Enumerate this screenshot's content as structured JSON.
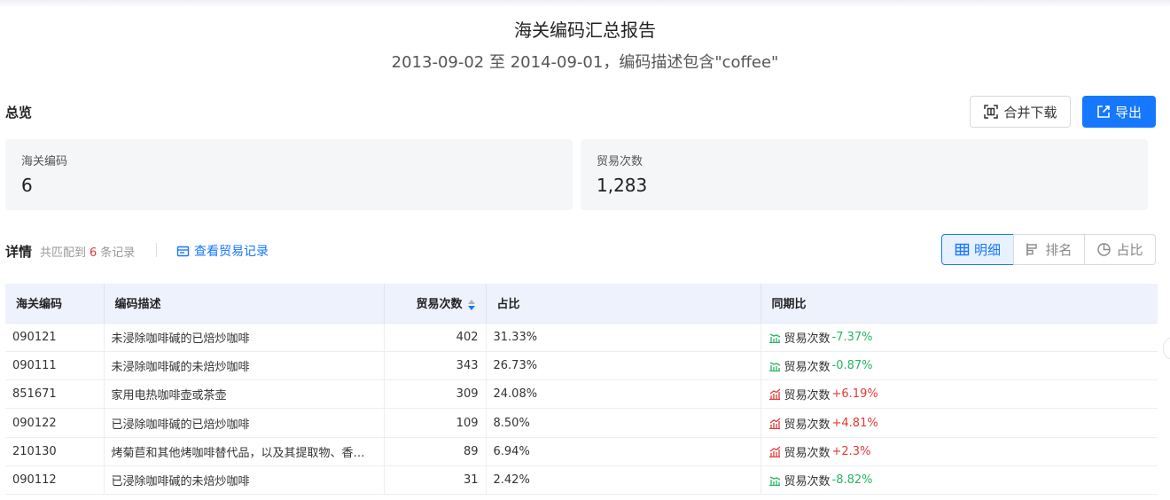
{
  "header": {
    "title": "海关编码汇总报告",
    "subtitle": "2013-09-02 至 2014-09-01，编码描述包含\"coffee\""
  },
  "overview": {
    "label": "总览",
    "merge_download_label": "合并下载",
    "export_label": "导出",
    "cards": [
      {
        "label": "海关编码",
        "value": "6"
      },
      {
        "label": "贸易次数",
        "value": "1,283"
      }
    ]
  },
  "detail": {
    "label": "详情",
    "match_prefix": "共匹配到",
    "match_count": "6",
    "match_suffix": "条记录",
    "view_records_label": "查看贸易记录",
    "view_tabs": [
      {
        "label": "明细",
        "icon": "table-icon",
        "active": true
      },
      {
        "label": "排名",
        "icon": "ranking-icon",
        "active": false
      },
      {
        "label": "占比",
        "icon": "pie-icon",
        "active": false
      }
    ]
  },
  "table": {
    "columns": [
      "海关编码",
      "编码描述",
      "贸易次数",
      "占比",
      "同期比"
    ],
    "rows": [
      {
        "code": "090121",
        "desc": "未浸除咖啡碱的已焙炒咖啡",
        "count": "402",
        "share": "31.33%",
        "yoy_label": "贸易次数",
        "yoy": "-7.37%",
        "trend": "down"
      },
      {
        "code": "090111",
        "desc": "未浸除咖啡碱的未焙炒咖啡",
        "count": "343",
        "share": "26.73%",
        "yoy_label": "贸易次数",
        "yoy": "-0.87%",
        "trend": "down"
      },
      {
        "code": "851671",
        "desc": "家用电热咖啡壶或茶壶",
        "count": "309",
        "share": "24.08%",
        "yoy_label": "贸易次数",
        "yoy": "+6.19%",
        "trend": "up"
      },
      {
        "code": "090122",
        "desc": "已浸除咖啡碱的已焙炒咖啡",
        "count": "109",
        "share": "8.50%",
        "yoy_label": "贸易次数",
        "yoy": "+4.81%",
        "trend": "up"
      },
      {
        "code": "210130",
        "desc": "烤菊苣和其他烤咖啡替代品，以及其提取物、香…",
        "count": "89",
        "share": "6.94%",
        "yoy_label": "贸易次数",
        "yoy": "+2.3%",
        "trend": "up"
      },
      {
        "code": "090112",
        "desc": "已浸除咖啡碱的未焙炒咖啡",
        "count": "31",
        "share": "2.42%",
        "yoy_label": "贸易次数",
        "yoy": "-8.82%",
        "trend": "down"
      }
    ]
  },
  "colors": {
    "accent": "#1677ff",
    "up": "#e53935",
    "down": "#28b463",
    "header_bg": "#eef2fc"
  }
}
